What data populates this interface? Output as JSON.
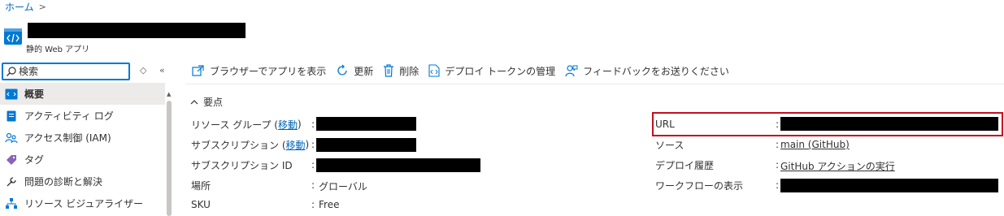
{
  "breadcrumb": {
    "home": "ホーム",
    "separator": ">"
  },
  "resource": {
    "type_label": "静的 Web アプリ"
  },
  "sidebar": {
    "search_placeholder": "検索",
    "items": [
      {
        "label": "概要",
        "icon": "overview-icon",
        "active": true
      },
      {
        "label": "アクティビティ ログ",
        "icon": "activity-log-icon"
      },
      {
        "label": "アクセス制御 (IAM)",
        "icon": "access-control-icon"
      },
      {
        "label": "タグ",
        "icon": "tag-icon"
      },
      {
        "label": "問題の診断と解決",
        "icon": "wrench-icon"
      },
      {
        "label": "リソース ビジュアライザー",
        "icon": "resource-visualizer-icon"
      }
    ]
  },
  "toolbar": {
    "browse": "ブラウザーでアプリを表示",
    "refresh": "更新",
    "delete": "削除",
    "manage_token": "デプロイ トークンの管理",
    "feedback": "フィードバックをお送りください"
  },
  "essentials": {
    "header": "要点",
    "left": [
      {
        "label": "リソース グループ (",
        "link": "移動",
        "label_end": ")",
        "value": ""
      },
      {
        "label": "サブスクリプション (",
        "link": "移動",
        "label_end": ")",
        "value": ""
      },
      {
        "label": "サブスクリプション ID",
        "value": ""
      },
      {
        "label": "場所",
        "value": "グローバル"
      },
      {
        "label": "SKU",
        "value": "Free"
      }
    ],
    "right": [
      {
        "label": "URL",
        "value": ""
      },
      {
        "label": "ソース",
        "value": "main (GitHub)"
      },
      {
        "label": "デプロイ履歴",
        "value": "GitHub アクションの実行"
      },
      {
        "label": "ワークフローの表示",
        "value": ""
      }
    ],
    "colon": ":"
  },
  "colors": {
    "accent": "#0078d4",
    "link": "#0067b8",
    "highlight": "#c50f1f"
  }
}
